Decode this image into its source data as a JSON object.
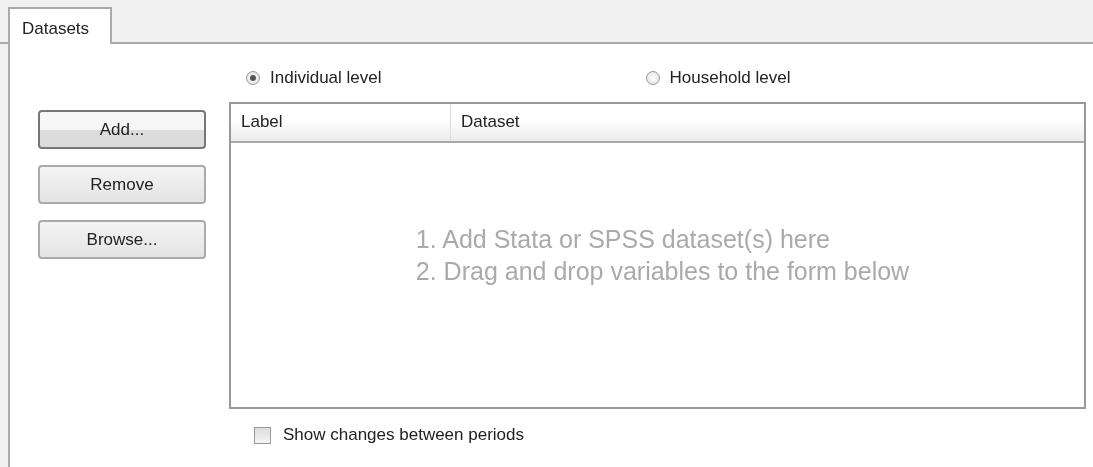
{
  "tabs": [
    {
      "label": "Datasets",
      "selected": true
    }
  ],
  "level_options": [
    {
      "label": "Individual level",
      "selected": true
    },
    {
      "label": "Household level",
      "selected": false
    }
  ],
  "buttons": [
    {
      "label": "Add...",
      "default": true
    },
    {
      "label": "Remove",
      "default": false
    },
    {
      "label": "Browse...",
      "default": false
    }
  ],
  "table": {
    "columns": [
      "Label",
      "Dataset"
    ],
    "hint_lines": [
      "1. Add Stata or SPSS dataset(s) here",
      "2. Drag and drop variables to the form below"
    ]
  },
  "show_changes": {
    "label": "Show changes between periods",
    "checked": false
  }
}
